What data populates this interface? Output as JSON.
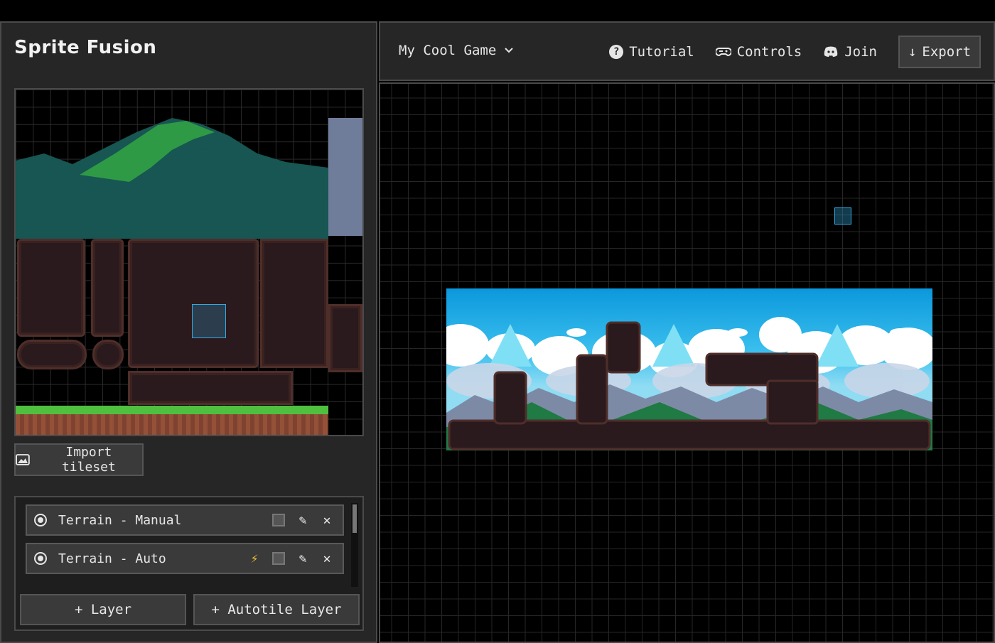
{
  "app": {
    "title": "Sprite Fusion"
  },
  "tileset": {
    "import_label": "Import tileset"
  },
  "layers": {
    "items": [
      {
        "name": "Terrain - Manual",
        "autotile": false
      },
      {
        "name": "Terrain - Auto",
        "autotile": true
      }
    ],
    "add_layer_label": "+ Layer",
    "add_autotile_label": "+ Autotile Layer"
  },
  "topbar": {
    "project_name": "My Cool Game",
    "tutorial_label": "Tutorial",
    "controls_label": "Controls",
    "join_label": "Join",
    "export_label": "Export"
  },
  "colors": {
    "accent": "#34a8e0",
    "panel": "#262626",
    "border": "#4a4a4a",
    "bolt": "#f4c430"
  }
}
